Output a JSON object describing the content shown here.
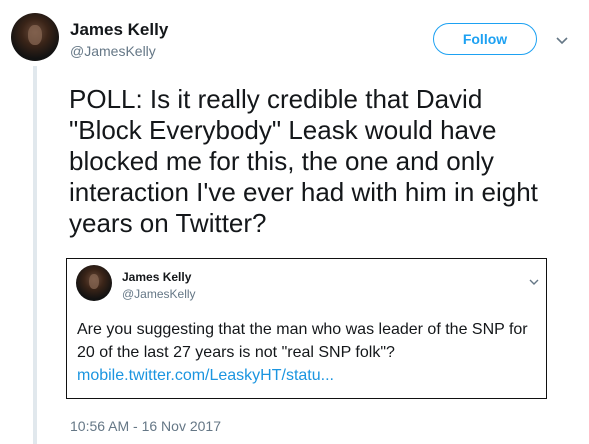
{
  "author": {
    "name": "James Kelly",
    "handle": "@JamesKelly",
    "avatar_icon": "profile-photo"
  },
  "actions": {
    "follow_label": "Follow",
    "menu_icon": "chevron-down-icon"
  },
  "tweet": {
    "text": "POLL: Is it really credible that David \"Block Everybody\" Leask would have blocked me for this, the one and only interaction I've ever had with him in eight years on Twitter?",
    "timestamp": "10:56 AM - 16 Nov 2017"
  },
  "quoted_tweet": {
    "name": "James Kelly",
    "handle": "@JamesKelly",
    "text": "Are you suggesting that the man who was leader of the SNP for 20 of the last 27 years is not \"real SNP folk\"?",
    "link": "mobile.twitter.com/LeaskyHT/statu..."
  },
  "colors": {
    "accent": "#1da1f2",
    "link": "#1b95e0",
    "muted": "#657786",
    "thread_line": "#e1e8ed"
  }
}
